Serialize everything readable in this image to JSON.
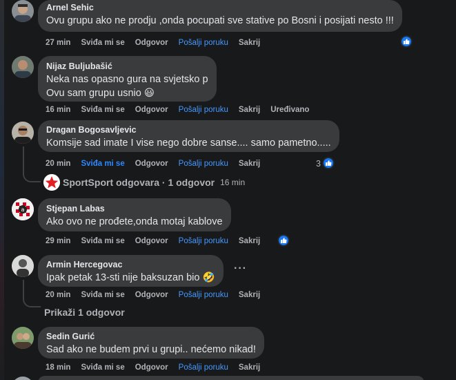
{
  "comments": [
    {
      "author": "Arnel Sehic",
      "lines": [
        "Ovu grupu ako ne prodju ,onda pocupati sve stative po Bosni i posijati nesto !!!"
      ],
      "time": "27 min",
      "like_label": "Sviđa mi se",
      "reply_label": "Odgovor",
      "message_label": "Pošalji poruku",
      "hide_label": "Sakrij"
    },
    {
      "author": "Nijaz Buljubašić",
      "lines": [
        "Neka nas opasno gura na svjetsko p",
        "Ovu sam grupu usnio 😃"
      ],
      "time": "16 min",
      "like_label": "Sviđa mi se",
      "reply_label": "Odgovor",
      "message_label": "Pošalji poruku",
      "hide_label": "Sakrij",
      "edited_label": "Uređivano"
    },
    {
      "author": "Dragan Bogosavljevic",
      "lines": [
        "Komsije sad imate I vise nego dobre sanse.... samo pametno....."
      ],
      "time": "20 min",
      "like_label": "Sviđa mi se",
      "reply_label": "Odgovor",
      "message_label": "Pošalji poruku",
      "hide_label": "Sakrij",
      "reaction_count": "3",
      "reply_summary": "SportSport odgovara · 1 odgovor",
      "reply_time": "16 min"
    },
    {
      "author": "Stjepan Labas",
      "lines": [
        "Ako ovo ne prođete,onda motaj kablove"
      ],
      "time": "29 min",
      "like_label": "Sviđa mi se",
      "reply_label": "Odgovor",
      "message_label": "Pošalji poruku",
      "hide_label": "Sakrij"
    },
    {
      "author": "Armin Hercegovac",
      "lines": [
        "Ipak petak 13-sti nije baksuzan bio 🤣"
      ],
      "time": "20 min",
      "like_label": "Sviđa mi se",
      "reply_label": "Odgovor",
      "message_label": "Pošalji poruku",
      "hide_label": "Sakrij",
      "more_label": "···",
      "show_replies": "Prikaži 1 odgovor"
    },
    {
      "author": "Sedin Gurić",
      "lines": [
        "Sad ako ne budem prvi u grupi.. nećemo nikad!"
      ],
      "time": "18 min",
      "like_label": "Sviđa mi se",
      "reply_label": "Odgovor",
      "message_label": "Pošalji poruku",
      "hide_label": "Sakrij"
    }
  ],
  "colors": {
    "background": "#18191a",
    "bubble": "#3a3b3c",
    "link_blue": "#2d88ff",
    "like_badge": "#1877f2",
    "secondary_text": "#b0b3b8"
  },
  "icons": [
    "thumbs-up-icon",
    "sportsport-logo-icon",
    "more-options-icon"
  ]
}
